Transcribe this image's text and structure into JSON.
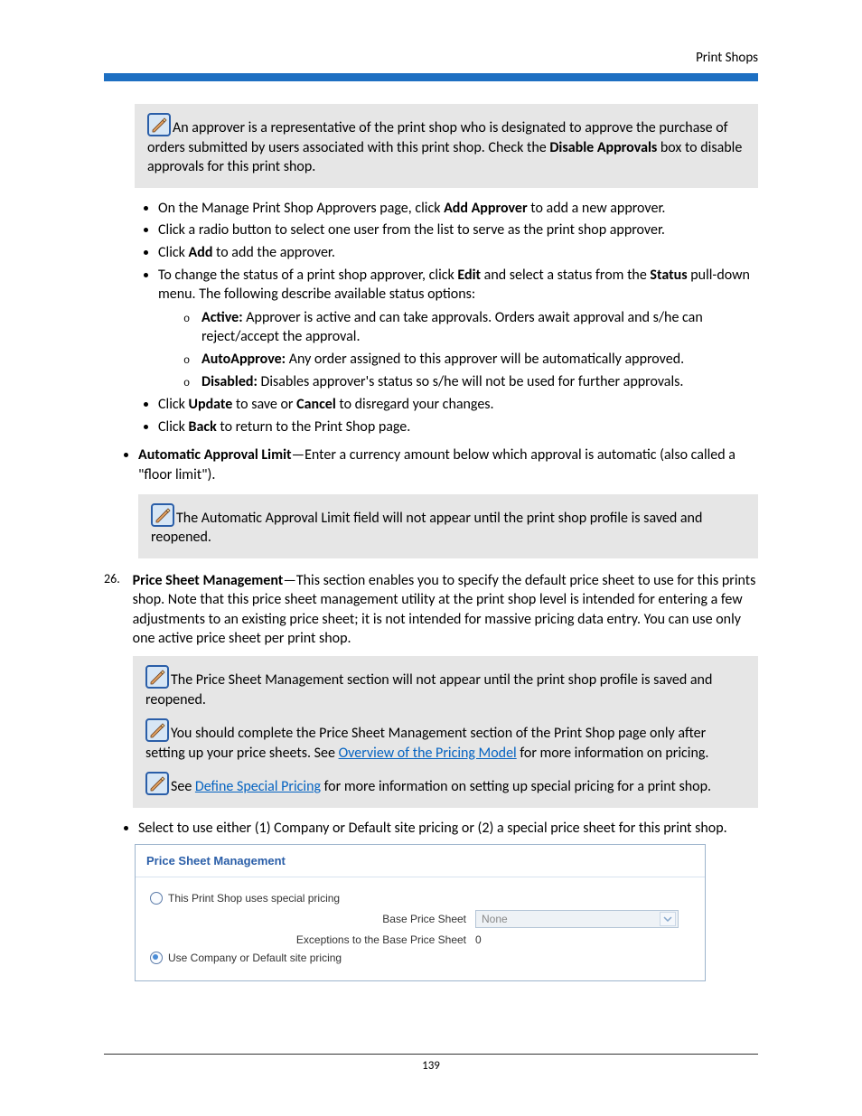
{
  "header": {
    "title": "Print Shops"
  },
  "notes": {
    "approver": "An approver is a representative of the print shop who is designated to approve the purchase of orders submitted by users associated with this print shop. Check the ",
    "approver_bold": "Disable Approvals",
    "approver_tail": " box to disable approvals for this print shop.",
    "aal": "The Automatic Approval Limit field will not appear until the print shop profile is saved and reopened.",
    "psm_saved": "The Price Sheet Management section will not appear until the print shop profile is saved and reopened.",
    "psm_after_pre": "You should complete the Price Sheet Management section of the Print Shop page only after setting up your price sheets. See ",
    "psm_after_link": "Overview of the Pricing Model",
    "psm_after_tail": " for more information on pricing.",
    "special_pre": "See ",
    "special_link": "Define Special Pricing",
    "special_tail": " for more information on setting up special pricing for a print shop."
  },
  "bullets": {
    "b1_pre": "On the Manage Print Shop Approvers page, click ",
    "b1_bold": "Add Approver",
    "b1_tail": " to add a new approver.",
    "b2": "Click a radio button to select one user from the list to serve as the print shop approver.",
    "b3_pre": "Click ",
    "b3_bold": "Add",
    "b3_tail": " to add the approver.",
    "b4_pre": "To change the status of a print shop approver, click ",
    "b4_bold1": "Edit",
    "b4_mid": " and select a status from the ",
    "b4_bold2": "Status",
    "b4_tail": " pull-down menu. The following describe available status options:",
    "s1_bold": "Active:",
    "s1_text": " Approver is active and can take approvals. Orders await approval and s/he can reject/accept the approval.",
    "s2_bold": "AutoApprove:",
    "s2_text": " Any order assigned to this approver will be automatically approved.",
    "s3_bold": "Disabled:",
    "s3_text": " Disables approver's status so s/he will not be used for further approvals.",
    "b5_pre": "Click ",
    "b5_bold1": "Update",
    "b5_mid": " to save or ",
    "b5_bold2": "Cancel",
    "b5_tail": " to disregard your changes.",
    "b6_pre": "Click ",
    "b6_bold": "Back",
    "b6_tail": " to return to the Print Shop page."
  },
  "outer": {
    "aal_bold": "Automatic Approval Limit",
    "aal_text": "—Enter a currency amount below which approval is automatic (also called a \"floor limit\").",
    "select_text": "Select to use either (1) Company or Default site pricing or (2) a special price sheet for this print shop."
  },
  "numbered": {
    "num": "26.",
    "bold": "Price Sheet Management",
    "text": "—This section enables you to specify the default price sheet to use for this prints shop. Note that this price sheet management utility at the print shop level is intended for entering a few adjustments to an existing price sheet; it is not intended for massive pricing data entry. You can use only one active price sheet per print shop."
  },
  "form": {
    "title": "Price Sheet Management",
    "option1": "This Print Shop uses special pricing",
    "base_label": "Base Price Sheet",
    "base_value": "None",
    "exc_label": "Exceptions to the Base Price Sheet",
    "exc_value": "0",
    "option2": "Use Company or Default site pricing"
  },
  "footer": {
    "page_number": "139"
  }
}
